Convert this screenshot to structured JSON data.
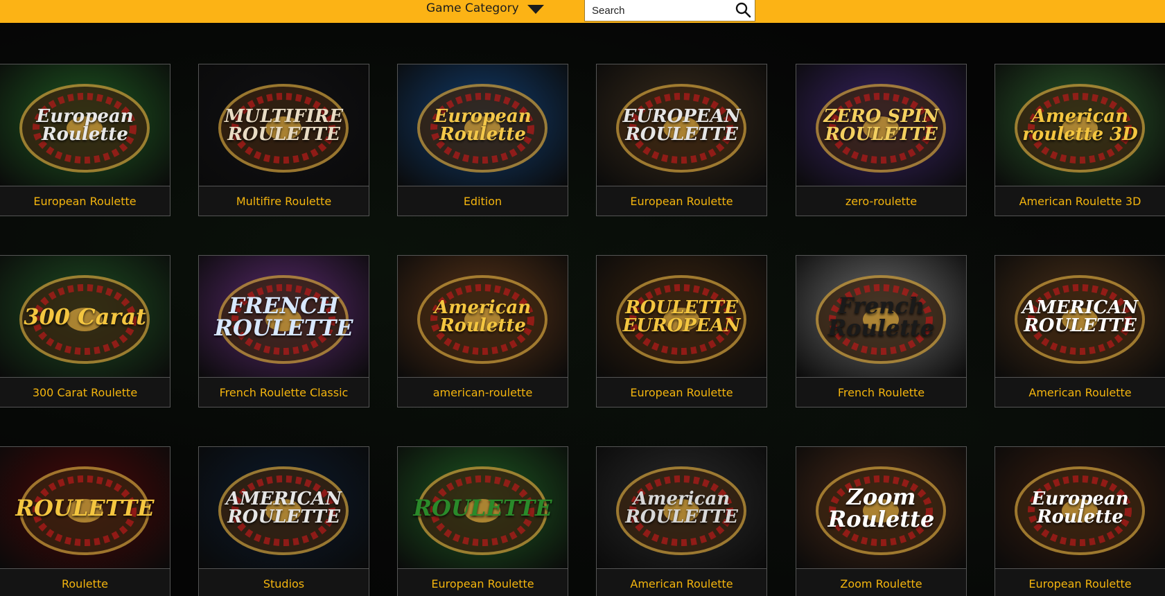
{
  "header": {
    "category_label": "Game Category",
    "search_placeholder": "Search"
  },
  "games": [
    {
      "caption": "European Roulette",
      "art": "European Roulette",
      "bg": "#1f5a22",
      "fg": "#e8e8e8"
    },
    {
      "caption": "Multifire Roulette",
      "art": "MULTIFIRE ROULETTE",
      "bg": "#111114",
      "fg": "#e9dcc4"
    },
    {
      "caption": "Edition",
      "art": "European Roulette",
      "bg": "#123d6e",
      "fg": "#f4c84a"
    },
    {
      "caption": "European Roulette",
      "art": "EUROPEAN ROULETTE",
      "bg": "#3a2c1c",
      "fg": "#e6e6e6"
    },
    {
      "caption": "zero-roulette",
      "art": "ZERO SPIN ROULETTE",
      "bg": "#3a2466",
      "fg": "#f4d060"
    },
    {
      "caption": "American Roulette 3D",
      "art": "American roulette 3D",
      "bg": "#2a5a2a",
      "fg": "#f4c640"
    },
    {
      "caption": "300 Carat Roulette",
      "art": "300 Carat",
      "bg": "#1e4d22",
      "fg": "#f4c640"
    },
    {
      "caption": "French Roulette Classic",
      "art": "FRENCH ROULETTE",
      "bg": "#5a2a6e",
      "fg": "#d8e8ff"
    },
    {
      "caption": "american-roulette",
      "art": "American Roulette",
      "bg": "#5a3418",
      "fg": "#f4c640"
    },
    {
      "caption": "European Roulette",
      "art": "ROULETTE EUROPEAN",
      "bg": "#3a2410",
      "fg": "#f4c640"
    },
    {
      "caption": "French Roulette",
      "art": "French Roulette",
      "bg": "#6e6e6e",
      "fg": "#1a1a1a"
    },
    {
      "caption": "American Roulette",
      "art": "AMERICAN ROULETTE",
      "bg": "#4a3018",
      "fg": "#ffffff"
    },
    {
      "caption": "Roulette",
      "art": "ROULETTE",
      "bg": "#4a0808",
      "fg": "#f4c640"
    },
    {
      "caption": "Studios",
      "art": "AMERICAN ROULETTE",
      "bg": "#0c1a2c",
      "fg": "#e6e6e6"
    },
    {
      "caption": "European Roulette",
      "art": "ROULETTE",
      "bg": "#1e5a22",
      "fg": "#2a8a2a"
    },
    {
      "caption": "American Roulette",
      "art": "American ROULETTE",
      "bg": "#2a2a2a",
      "fg": "#d8d8d8"
    },
    {
      "caption": "Zoom Roulette",
      "art": "Zoom Roulette",
      "bg": "#4a2a18",
      "fg": "#ffffff"
    },
    {
      "caption": "European Roulette",
      "art": "European Roulette",
      "bg": "#3a1e10",
      "fg": "#ffffff"
    }
  ]
}
